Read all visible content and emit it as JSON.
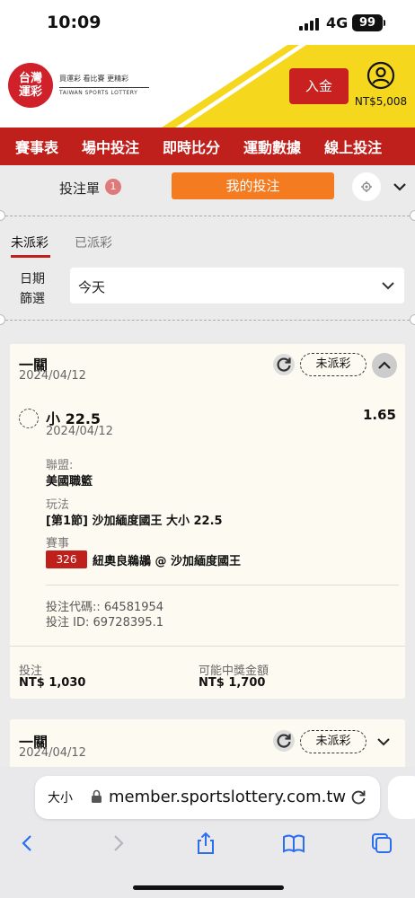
{
  "status": {
    "time": "10:09",
    "network": "4G",
    "battery": "99"
  },
  "header": {
    "logo_line1": "台灣",
    "logo_line2": "運彩",
    "slogan": "買運彩 看比賽 更精彩",
    "brand_en": "TAIWAN SPORTS LOTTERY",
    "deposit_label": "入金",
    "balance": "NT$5,008"
  },
  "nav": {
    "items": [
      "賽事表",
      "場中投注",
      "即時比分",
      "運動數據",
      "線上投注"
    ]
  },
  "slip": {
    "label": "投注單",
    "count": "1",
    "my_bets_label": "我的投注"
  },
  "tabs": {
    "unsettled": "未派彩",
    "settled": "已派彩"
  },
  "date_filter": {
    "label_line1": "日期",
    "label_line2": "篩選",
    "value": "今天"
  },
  "bets": [
    {
      "type": "一關",
      "date": "2024/04/12",
      "status": "未派彩",
      "selection": "小 22.5",
      "selection_date": "2024/04/12",
      "odds": "1.65",
      "league_label": "聯盟:",
      "league": "美國職籃",
      "market_label": "玩法",
      "market": "[第1節] 沙加緬度國王 大小 22.5",
      "event_label": "賽事",
      "match_no": "326",
      "match": "紐奧良鵜鶘 @ 沙加緬度國王",
      "code_line": "投注代碼:: 64581954",
      "id_line": "投注 ID: 69728395.1",
      "stake_label": "投注",
      "stake": "NT$ 1,030",
      "payout_label": "可能中獎金額",
      "payout": "NT$ 1,700"
    },
    {
      "type": "一關",
      "date": "2024/04/12",
      "status": "未派彩"
    }
  ],
  "browser": {
    "aa": "大小",
    "url": "member.sportslottery.com.tw"
  },
  "colors": {
    "brand_red": "#c0201c",
    "accent_orange": "#f47b20",
    "yellow": "#f5d81e"
  }
}
